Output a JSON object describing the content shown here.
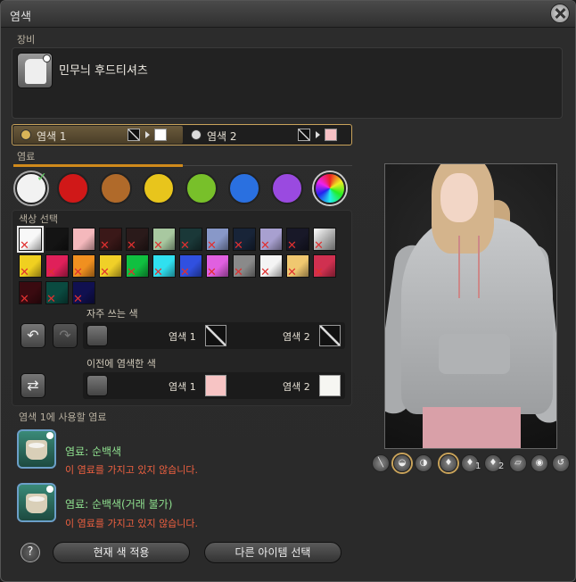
{
  "window": {
    "title": "염색"
  },
  "equipment": {
    "section_label": "장비",
    "item_name": "민무늬 후드티셔츠",
    "icon": "hoodie-icon"
  },
  "dye_tabs": [
    {
      "label": "염색 1",
      "current_color": "#ffffff",
      "active": true
    },
    {
      "label": "염색 2",
      "current_color": "#f7c0c4",
      "active": false
    }
  ],
  "dyes_section": {
    "label": "염료"
  },
  "categories": [
    {
      "name": "white",
      "color": "#f2f2f2",
      "selected": true
    },
    {
      "name": "red",
      "color": "#d01818"
    },
    {
      "name": "brown",
      "color": "#b06a2a"
    },
    {
      "name": "yellow",
      "color": "#e8c51c"
    },
    {
      "name": "green",
      "color": "#78c02a"
    },
    {
      "name": "blue",
      "color": "#2a70e0"
    },
    {
      "name": "purple",
      "color": "#9a4ae0"
    },
    {
      "name": "special",
      "color": "rainbow"
    }
  ],
  "color_picker": {
    "label": "색상 선택",
    "rows": [
      [
        {
          "c": "#f8f8f8",
          "sel": true,
          "x": true
        },
        {
          "c": "#141414"
        },
        {
          "c": "#f4b8bc"
        },
        {
          "c": "#3a1818",
          "x": true
        },
        {
          "c": "#2a1a1a",
          "x": true
        },
        {
          "c": "#a8c8a0",
          "x": true
        },
        {
          "c": "#1a3838",
          "x": true
        },
        {
          "c": "#8898c8",
          "x": true
        },
        {
          "c": "#182438",
          "x": true
        },
        {
          "c": "#a8a0d0",
          "x": true
        },
        {
          "c": "#181828",
          "x": true
        },
        {
          "c": "#e8e8e8",
          "x": true,
          "grad": true
        }
      ],
      [
        {
          "c": "#f0d020",
          "x": true
        },
        {
          "c": "#e0205a",
          "x": true
        },
        {
          "c": "#f09020",
          "x": true
        },
        {
          "c": "#f0d028",
          "x": true
        },
        {
          "c": "#10c040",
          "x": true
        },
        {
          "c": "#30e0f0",
          "x": true
        },
        {
          "c": "#3050e0",
          "x": true
        },
        {
          "c": "#e060e0",
          "x": true
        },
        {
          "c": "#8a8a8a",
          "x": true
        },
        {
          "c": "#f4f4f4",
          "x": true
        },
        {
          "c": "#f0c870",
          "x": true
        },
        {
          "c": "#d03050",
          "x": true
        }
      ],
      [
        {
          "c": "#3a0a10",
          "x": true
        },
        {
          "c": "#0a4a40",
          "x": true
        },
        {
          "c": "#101050",
          "x": true
        }
      ]
    ],
    "frequent_label": "자주 쓰는 색",
    "frequent": {
      "dye1_label": "염색 1",
      "dye2_label": "염색 2",
      "dye1_color": "",
      "dye2_color": ""
    },
    "previous_label": "이전에 염색한 색",
    "previous": {
      "dye1_label": "염색 1",
      "dye2_label": "염색 2",
      "dye1_color": "#f7c4c4",
      "dye2_color": "#f6f6f2"
    }
  },
  "dye_usage": {
    "label": "염색 1에 사용할 염료",
    "items": [
      {
        "name": "염료: 순백색",
        "warning": "이 염료를 가지고 있지 않습니다."
      },
      {
        "name": "염료: 순백색(거래 불가)",
        "warning": "이 염료를 가지고 있지 않습니다."
      }
    ]
  },
  "footer": {
    "help": "?",
    "apply_label": "현재 색 적용",
    "other_item_label": "다른 아이템 선택"
  },
  "preview_controls": [
    "weapon-toggle-icon",
    "headgear-icon",
    "visor-icon",
    "preview-dye1-icon",
    "preview-dye2-icon",
    "compare-icon",
    "lighting-icon",
    "eye-icon",
    "reset-view-icon"
  ],
  "preview_labels": {
    "n1": "1",
    "n2": "2"
  }
}
